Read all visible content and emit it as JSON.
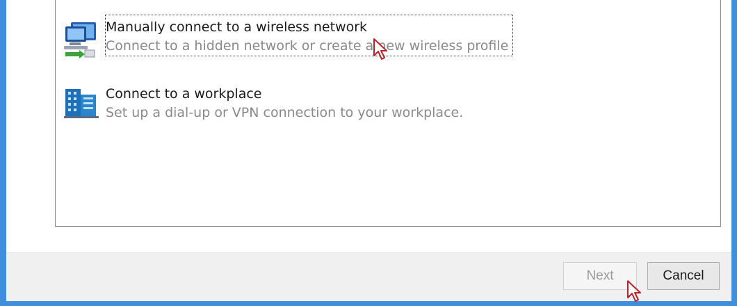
{
  "options": [
    {
      "title": "Manually connect to a wireless network",
      "description": "Connect to a hidden network or create a new wireless profile",
      "icon": "wireless-network-computer-icon",
      "focused": true
    },
    {
      "title": "Connect to a workplace",
      "description": "Set up a dial-up or VPN connection to your workplace.",
      "icon": "workplace-building-icon",
      "focused": false
    }
  ],
  "buttons": {
    "next_label": "Next",
    "next_enabled": false,
    "cancel_label": "Cancel"
  },
  "colors": {
    "frame": "#3f8fdd",
    "title_text": "#1a1a1a",
    "desc_text": "#8a8a8a",
    "footer_bg": "#f0f0f0"
  }
}
